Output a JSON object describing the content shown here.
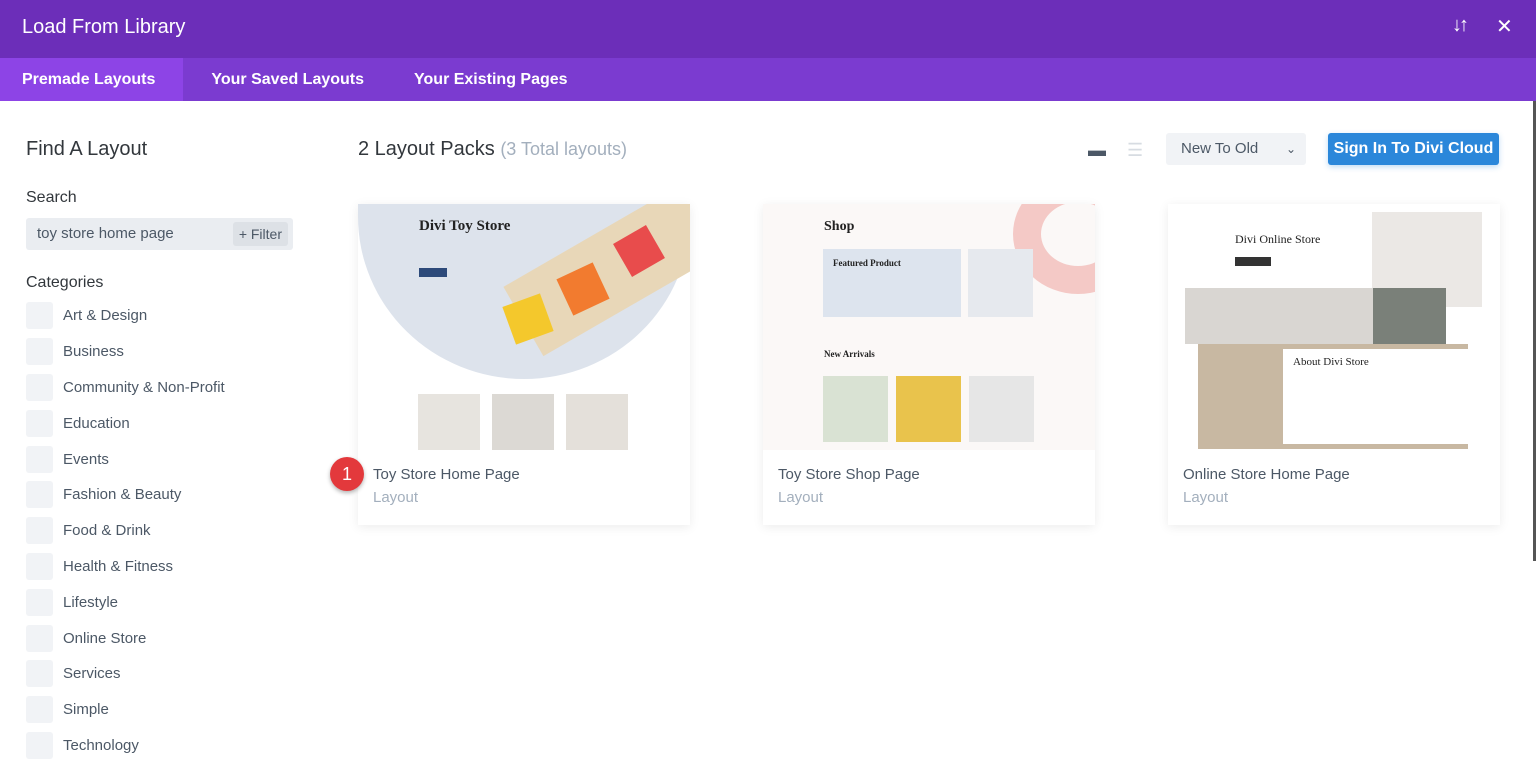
{
  "header": {
    "title": "Load From Library",
    "sort_icon": "sort-arrows-icon",
    "close_icon": "close-icon"
  },
  "tabs": [
    {
      "label": "Premade Layouts",
      "active": true
    },
    {
      "label": "Your Saved Layouts"
    },
    {
      "label": "Your Existing Pages"
    }
  ],
  "sidebar": {
    "heading": "Find A Layout",
    "search_label": "Search",
    "search_value": "toy store home page",
    "filter_label": "+ Filter",
    "categories_label": "Categories",
    "categories": [
      "Art & Design",
      "Business",
      "Community & Non-Profit",
      "Education",
      "Events",
      "Fashion & Beauty",
      "Food & Drink",
      "Health & Fitness",
      "Lifestyle",
      "Online Store",
      "Services",
      "Simple",
      "Technology"
    ]
  },
  "main": {
    "count_title": "2 Layout Packs",
    "count_sub": "(3 Total layouts)",
    "grid_view_icon": "folder-icon",
    "list_view_icon": "list-icon",
    "sort_value": "New To Old",
    "cloud_button": "Sign In To Divi Cloud",
    "badge": "1",
    "accent": "#2b87da",
    "header_color": "#6c2eb9",
    "tab_color": "#7b3bd0",
    "cards": [
      {
        "name": "Toy Store Home Page",
        "type": "Layout",
        "thumb_title": "Divi Toy Store"
      },
      {
        "name": "Toy Store Shop Page",
        "type": "Layout",
        "thumb_title": "Shop",
        "thumb_featured": "Featured Product",
        "thumb_new": "New Arrivals"
      },
      {
        "name": "Online Store Home Page",
        "type": "Layout",
        "thumb_title": "Divi Online Store",
        "thumb_about": "About Divi Store"
      }
    ]
  }
}
